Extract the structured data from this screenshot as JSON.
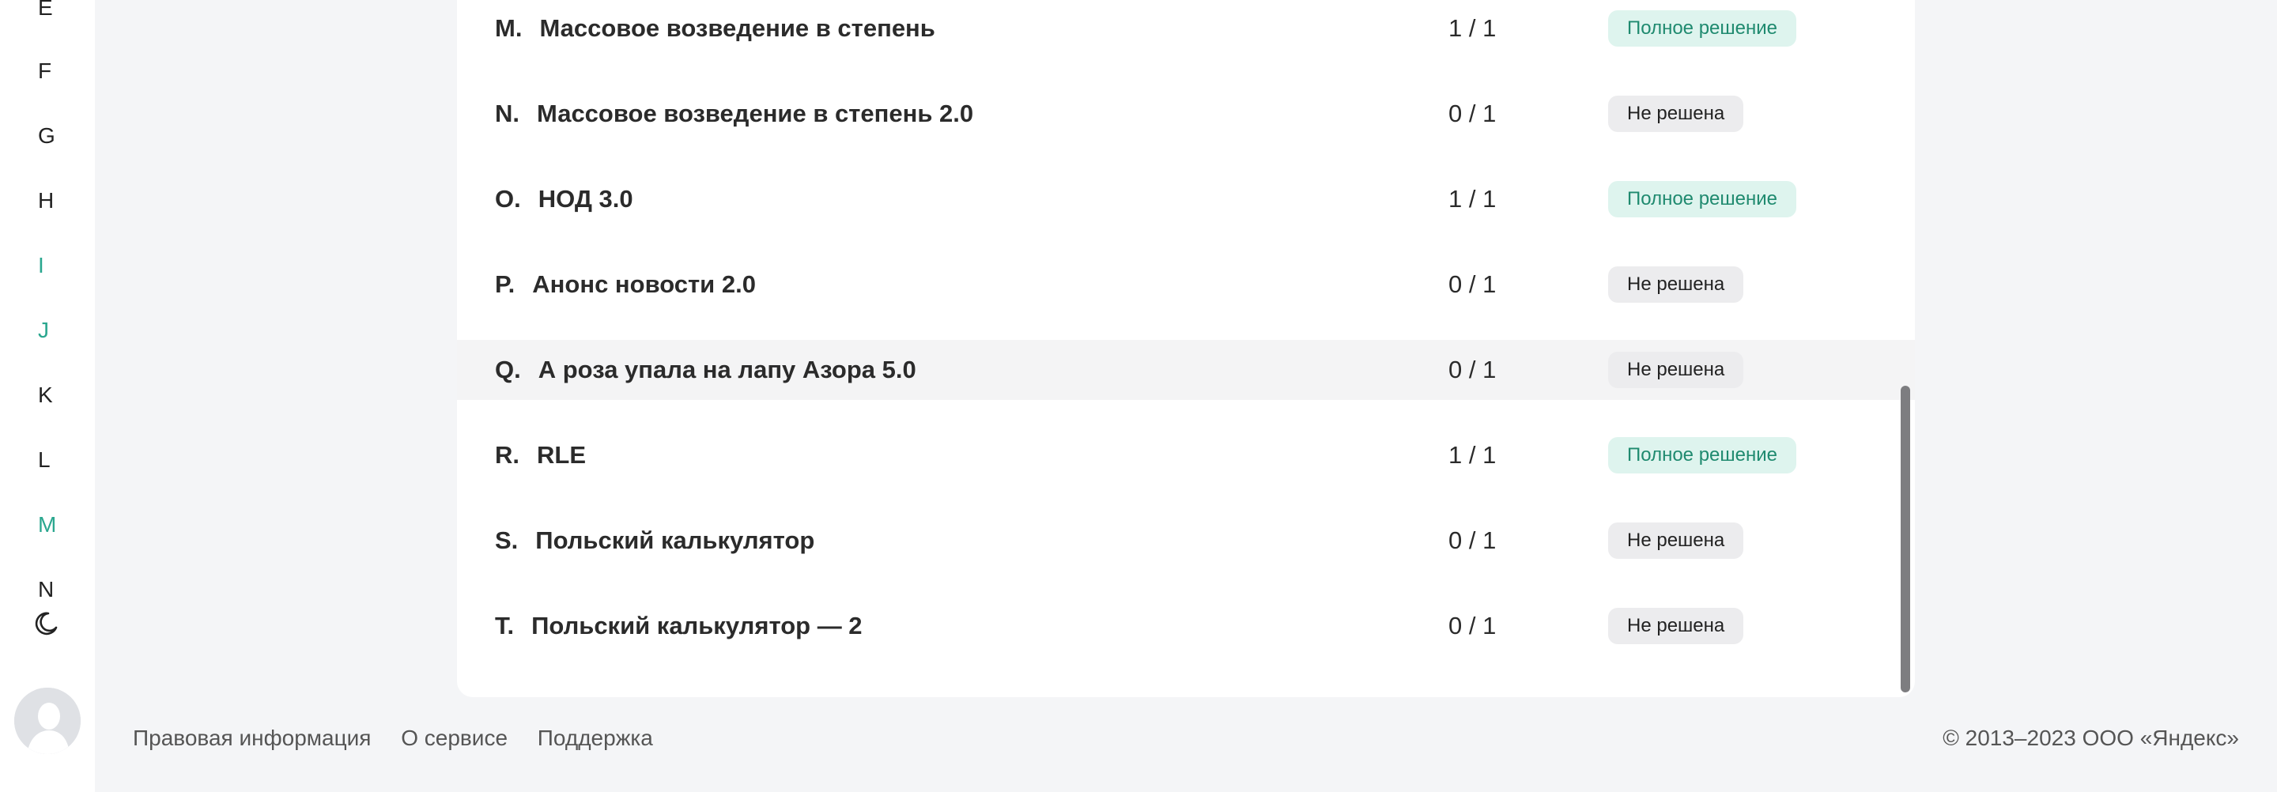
{
  "sidebar": {
    "letters": [
      {
        "label": "E",
        "accent": false
      },
      {
        "label": "F",
        "accent": false
      },
      {
        "label": "G",
        "accent": false
      },
      {
        "label": "H",
        "accent": false
      },
      {
        "label": "I",
        "accent": true
      },
      {
        "label": "J",
        "accent": true
      },
      {
        "label": "K",
        "accent": false
      },
      {
        "label": "L",
        "accent": false
      },
      {
        "label": "M",
        "accent": true
      },
      {
        "label": "N",
        "accent": false
      }
    ],
    "theme_icon": "moon-icon",
    "avatar_icon": "user-avatar-icon"
  },
  "problems": [
    {
      "id": "M.",
      "name": "Массовое возведение в степень",
      "score": "1 / 1",
      "status": "Полное решение",
      "solved": true
    },
    {
      "id": "N.",
      "name": "Массовое возведение в степень 2.0",
      "score": "0 / 1",
      "status": "Не решена",
      "solved": false
    },
    {
      "id": "O.",
      "name": "НОД 3.0",
      "score": "1 / 1",
      "status": "Полное решение",
      "solved": true
    },
    {
      "id": "P.",
      "name": "Анонс новости 2.0",
      "score": "0 / 1",
      "status": "Не решена",
      "solved": false
    },
    {
      "id": "Q.",
      "name": "А роза упала на лапу Азора 5.0",
      "score": "0 / 1",
      "status": "Не решена",
      "solved": false
    },
    {
      "id": "R.",
      "name": "RLE",
      "score": "1 / 1",
      "status": "Полное решение",
      "solved": true
    },
    {
      "id": "S.",
      "name": "Польский калькулятор",
      "score": "0 / 1",
      "status": "Не решена",
      "solved": false
    },
    {
      "id": "T.",
      "name": "Польский калькулятор — 2",
      "score": "0 / 1",
      "status": "Не решена",
      "solved": false
    }
  ],
  "footer": {
    "links": [
      "Правовая информация",
      "О сервисе",
      "Поддержка"
    ],
    "copyright": "© 2013–2023 ООО «Яндекс»"
  },
  "colors": {
    "accent": "#2ba78f",
    "solved_badge_bg": "#def4ee",
    "unsolved_badge_bg": "#ececee",
    "page_bg": "#f4f5f7"
  }
}
